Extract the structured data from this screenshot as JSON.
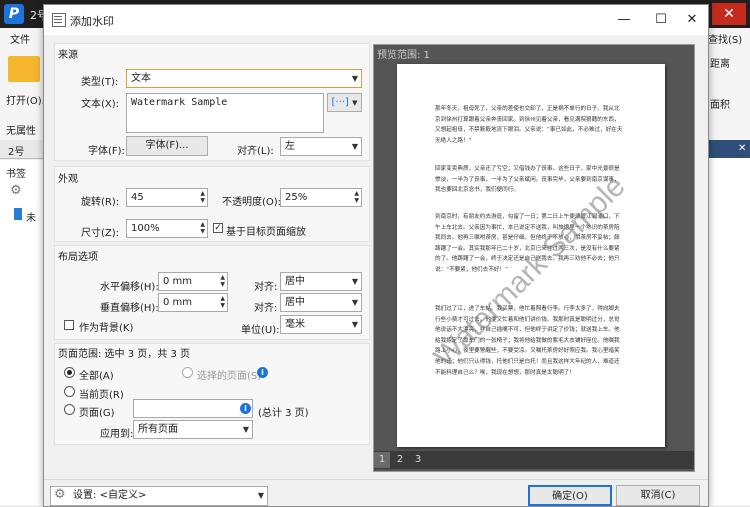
{
  "app": {
    "logo": "P",
    "title": "2号",
    "menu_file": "文件",
    "menu_find": "查找(S)",
    "open_label": "打开(O)...",
    "attr_label": "无属性",
    "dist_label": "距离",
    "area_label": "面积",
    "doc_tab": "2号",
    "bookmark_label": "书签",
    "bookmark_item": "未"
  },
  "dialog": {
    "title": "添加水印",
    "min_glyph": "—",
    "max_glyph": "☐",
    "close_glyph": "✕",
    "source": {
      "title": "来源",
      "type_label": "类型(T):",
      "type_value": "文本",
      "text_label": "文本(X):",
      "text_value": "Watermark Sample",
      "font_label": "字体(F):",
      "font_button": "字体(F)...",
      "align_label": "对齐(L):",
      "align_value": "左"
    },
    "appearance": {
      "title": "外观",
      "rotation_label": "旋转(R):",
      "rotation_value": "45",
      "opacity_label": "不透明度(O):",
      "opacity_value": "25%",
      "size_label": "尺寸(Z):",
      "size_value": "100%",
      "scale_label": "基于目标页面缩放",
      "scale_checked": true
    },
    "layout": {
      "title": "布局选项",
      "h_offset_label": "水平偏移(H):",
      "h_offset_value": "0 mm",
      "h_align_label": "对齐:",
      "h_align_value": "居中",
      "v_offset_label": "垂直偏移(H):",
      "v_offset_value": "0 mm",
      "v_align_label": "对齐:",
      "v_align_value": "居中",
      "background_label": "作为背景(K)",
      "background_checked": false,
      "unit_label": "单位(U):",
      "unit_value": "毫米"
    },
    "page_range": {
      "title": "页面范围: 选中 3 页，共 3 页",
      "all_label": "全部(A)",
      "selected_label": "选择的页面(S)",
      "current_label": "当前页(R)",
      "pages_label": "页面(G)",
      "pages_value": "",
      "total_label": "(总计 3 页)",
      "apply_label": "应用到:",
      "apply_value": "所有页面",
      "selected_option": "all"
    },
    "preview": {
      "title": "预览范围: 1",
      "watermark_text": "Watermark Sample",
      "page_tabs": [
        "1",
        "2",
        "3"
      ],
      "active_tab": "1",
      "paragraphs": [
        "那年冬天，祖母死了，父亲的差使也交卸了，正是祸不单行的日子。我从北京到徐州打算跟着父亲奔丧回家。到徐州见着父亲，看见满院狼藉的东西，又想起祖母，不禁簌簌地流下眼泪。父亲说：“事已如此，不必难过，好在天无绝人之路！”",
        "回家变卖典质，父亲还了亏空；又借钱办了丧事。这些日子，家中光景很是惨淡，一半为了丧事，一半为了父亲赋闲。丧事完毕，父亲要到南京谋事，我也要回北京念书，我们便同行。",
        "到南京时，有朋友约去游逛，勾留了一日；第二日上午便须渡江到浦口，下午上车北去。父亲因为事忙，本已说定不送我，叫旅馆里一个熟识的茶房陪我同去。他再三嘱咐茶房，甚是仔细。但他终于不放心，怕茶房不妥帖；颇踌躇了一会。其实我那年已二十岁，北京已来往过两三次，是没有什么要紧的了。他踌躇了一会，终于决定还是自己送我去。我再三劝他不必去；他只说：“不要紧，他们去不好！”",
        "我们过了江，进了车站。我买票，他忙着照看行李。行李太多了，得向脚夫行些小费才可过去。他便又忙着和他们讲价钱。我那时真是聪明过分，总觉他说话不大漂亮，非自己插嘴不可，但他终于讲定了价钱；就送我上车。他给我拣定了靠车门的一张椅子；我将他给我做的紫毛大衣铺好座位。他嘱我路上小心，夜里要警醒些，不要受凉。又嘱托茶房好好照应我。我心里暗笑他的迂；他们只认得钱，托他们只是白托！而且我这样大年纪的人，难道还不能料理自己么？唉，我现在想想，那时真是太聪明了！"
      ]
    },
    "footer": {
      "settings_label": "设置:",
      "settings_value": "<自定义>",
      "ok_label": "确定(O)",
      "cancel_label": "取消(C)"
    }
  }
}
